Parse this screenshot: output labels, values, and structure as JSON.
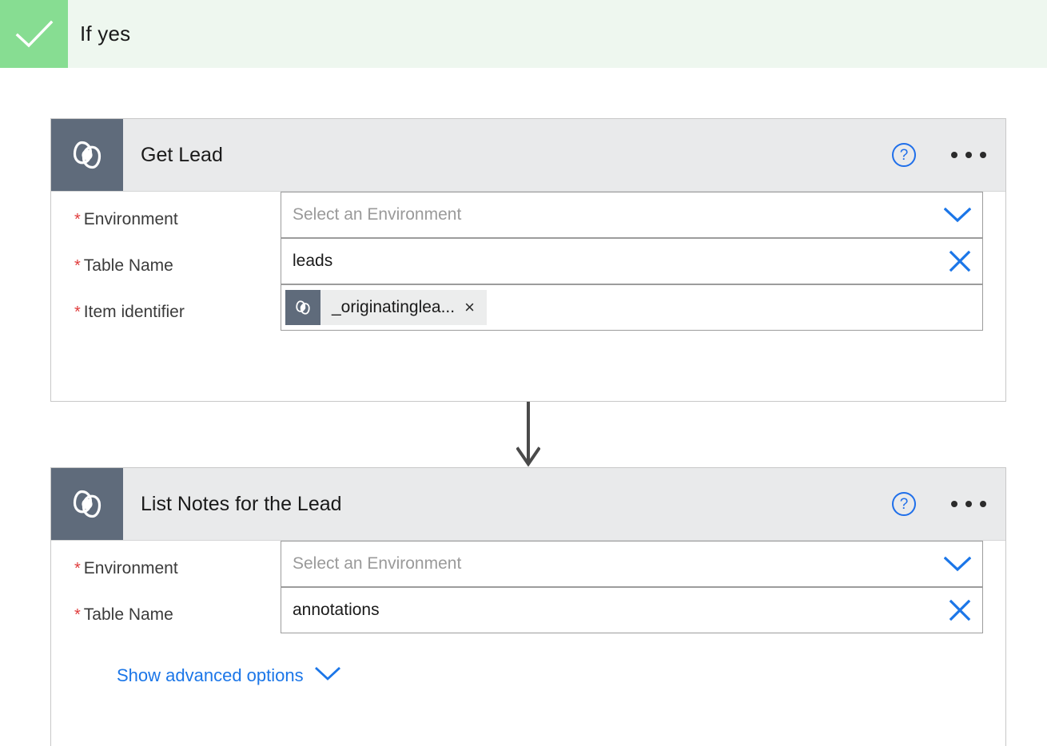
{
  "branch": {
    "label": "If yes",
    "check_icon": "check-icon",
    "accent_color": "#87dd92",
    "background_color": "#eef7ef"
  },
  "theme": {
    "connector_icon_bg": "#5f6b7b",
    "card_header_bg": "#e9eaeb",
    "link_blue": "#1b76e8",
    "required_red": "#e03c3c",
    "arrow_gray": "#4a4a4a"
  },
  "cards": [
    {
      "title": "Get Lead",
      "icon": "dataverse-icon",
      "help_icon": "help-circle-icon",
      "help_label": "?",
      "menu_icon": "ellipsis-icon",
      "fields": [
        {
          "label": "Environment",
          "required": true,
          "type": "dropdown",
          "value": "",
          "placeholder": "Select an Environment",
          "affordance": "chevron-down-icon"
        },
        {
          "label": "Table Name",
          "required": true,
          "type": "combobox",
          "value": "leads",
          "placeholder": "",
          "affordance": "clear-x-icon"
        },
        {
          "label": "Item identifier",
          "required": true,
          "type": "token",
          "token": {
            "icon": "dataverse-icon",
            "label": "_originatinglea...",
            "remove_icon": "remove-token-x-icon",
            "remove_label": "×"
          }
        }
      ]
    },
    {
      "title": "List Notes for the Lead",
      "icon": "dataverse-icon",
      "help_icon": "help-circle-icon",
      "help_label": "?",
      "menu_icon": "ellipsis-icon",
      "fields": [
        {
          "label": "Environment",
          "required": true,
          "type": "dropdown",
          "value": "",
          "placeholder": "Select an Environment",
          "affordance": "chevron-down-icon"
        },
        {
          "label": "Table Name",
          "required": true,
          "type": "combobox",
          "value": "annotations",
          "placeholder": "",
          "affordance": "clear-x-icon"
        }
      ],
      "advanced_options": {
        "label": "Show advanced options",
        "icon": "chevron-down-icon"
      }
    }
  ],
  "connector": {
    "icon": "arrow-down-icon"
  }
}
